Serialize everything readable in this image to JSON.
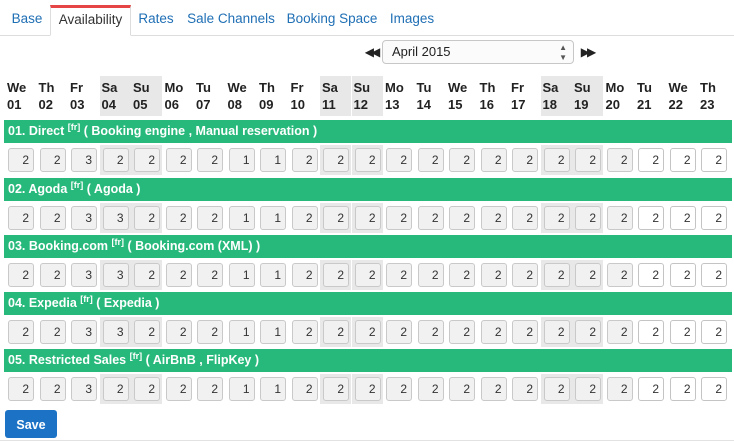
{
  "tabs": [
    {
      "label": "Base"
    },
    {
      "label": "Availability",
      "active": true
    },
    {
      "label": "Rates"
    },
    {
      "label": "Sale Channels"
    },
    {
      "label": "Booking Space"
    },
    {
      "label": "Images"
    }
  ],
  "month_nav": {
    "prev_icon": "double-left-arrow-icon",
    "next_icon": "double-right-arrow-icon",
    "selected_month": "April 2015",
    "prev_glyph": "◀◀",
    "next_glyph": "▶▶"
  },
  "days": [
    {
      "dow": "We",
      "num": "01",
      "weekend": false
    },
    {
      "dow": "Th",
      "num": "02",
      "weekend": false
    },
    {
      "dow": "Fr",
      "num": "03",
      "weekend": false
    },
    {
      "dow": "Sa",
      "num": "04",
      "weekend": true
    },
    {
      "dow": "Su",
      "num": "05",
      "weekend": true
    },
    {
      "dow": "Mo",
      "num": "06",
      "weekend": false
    },
    {
      "dow": "Tu",
      "num": "07",
      "weekend": false
    },
    {
      "dow": "We",
      "num": "08",
      "weekend": false
    },
    {
      "dow": "Th",
      "num": "09",
      "weekend": false
    },
    {
      "dow": "Fr",
      "num": "10",
      "weekend": false
    },
    {
      "dow": "Sa",
      "num": "11",
      "weekend": true
    },
    {
      "dow": "Su",
      "num": "12",
      "weekend": true
    },
    {
      "dow": "Mo",
      "num": "13",
      "weekend": false
    },
    {
      "dow": "Tu",
      "num": "14",
      "weekend": false
    },
    {
      "dow": "We",
      "num": "15",
      "weekend": false
    },
    {
      "dow": "Th",
      "num": "16",
      "weekend": false
    },
    {
      "dow": "Fr",
      "num": "17",
      "weekend": false
    },
    {
      "dow": "Sa",
      "num": "18",
      "weekend": true
    },
    {
      "dow": "Su",
      "num": "19",
      "weekend": true
    },
    {
      "dow": "Mo",
      "num": "20",
      "weekend": false
    },
    {
      "dow": "Tu",
      "num": "21",
      "weekend": false
    },
    {
      "dow": "We",
      "num": "22",
      "weekend": false
    },
    {
      "dow": "Th",
      "num": "23",
      "weekend": false
    }
  ],
  "channels": [
    {
      "name": "01. Direct",
      "tag": "[fr]",
      "sources": "( Booking engine , Manual reservation )",
      "values": [
        "2",
        "2",
        "3",
        "2",
        "2",
        "2",
        "2",
        "1",
        "1",
        "2",
        "2",
        "2",
        "2",
        "2",
        "2",
        "2",
        "2",
        "2",
        "2",
        "2",
        "2",
        "2",
        "2"
      ]
    },
    {
      "name": "02. Agoda",
      "tag": "[fr]",
      "sources": "( Agoda )",
      "values": [
        "2",
        "2",
        "3",
        "3",
        "2",
        "2",
        "2",
        "1",
        "1",
        "2",
        "2",
        "2",
        "2",
        "2",
        "2",
        "2",
        "2",
        "2",
        "2",
        "2",
        "2",
        "2",
        "2"
      ]
    },
    {
      "name": "03. Booking.com",
      "tag": "[fr]",
      "sources": "( Booking.com (XML) )",
      "values": [
        "2",
        "2",
        "3",
        "3",
        "2",
        "2",
        "2",
        "1",
        "1",
        "2",
        "2",
        "2",
        "2",
        "2",
        "2",
        "2",
        "2",
        "2",
        "2",
        "2",
        "2",
        "2",
        "2"
      ]
    },
    {
      "name": "04. Expedia",
      "tag": "[fr]",
      "sources": "( Expedia )",
      "values": [
        "2",
        "2",
        "3",
        "3",
        "2",
        "2",
        "2",
        "1",
        "1",
        "2",
        "2",
        "2",
        "2",
        "2",
        "2",
        "2",
        "2",
        "2",
        "2",
        "2",
        "2",
        "2",
        "2"
      ]
    },
    {
      "name": "05. Restricted Sales",
      "tag": "[fr]",
      "sources": "( AirBnB , FlipKey )",
      "values": [
        "2",
        "2",
        "3",
        "2",
        "2",
        "2",
        "2",
        "1",
        "1",
        "2",
        "2",
        "2",
        "2",
        "2",
        "2",
        "2",
        "2",
        "2",
        "2",
        "2",
        "2",
        "2",
        "2"
      ]
    }
  ],
  "open_from_index": 20,
  "save_label": "Save"
}
